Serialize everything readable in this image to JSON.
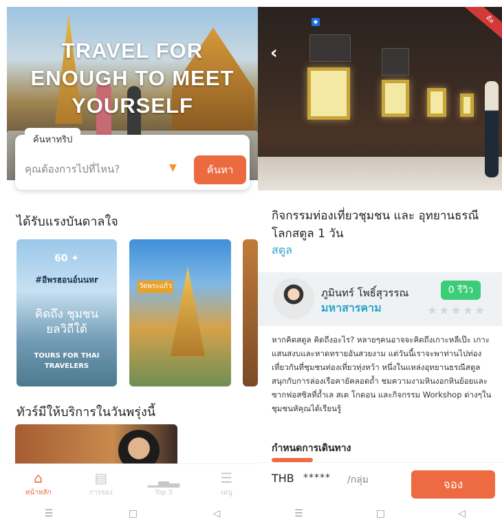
{
  "left": {
    "hero": {
      "title": "TRAVEL FOR\nENOUGH TO MEET\nYOURSELF"
    },
    "search": {
      "tab_label": "ค้นหาทริป",
      "placeholder": "คุณต้องการไปที่ไหน?",
      "button_label": "ค้นหา"
    },
    "inspiration_title": "ได้รับแรงบันดาลใจ",
    "promos": [
      {
        "hashtag": "#อีพรฮอนอ์นนหr",
        "headline": "คิดถึง ชุมชน\nยลวิถีใต้",
        "footer": "TOURS FOR THAI\nTRAVELERS"
      },
      {
        "caption": "วัดพระแก้ว"
      }
    ],
    "tomorrow_title": "ทัวร์มีให้บริการในวันพรุ่งนี้",
    "nav": [
      {
        "label": "หน้าหลัก",
        "icon": "home-icon",
        "active": true
      },
      {
        "label": "การจอง",
        "icon": "booking-icon",
        "active": false
      },
      {
        "label": "Top 5",
        "icon": "chart-icon",
        "active": false
      },
      {
        "label": "เมนู",
        "icon": "menu-icon",
        "active": false
      }
    ]
  },
  "right": {
    "gallery": {
      "badge": "ดีล"
    },
    "activity": {
      "title": "กิจกรรมท่องเที่ยวชุมชน และ อุทยานธรณีโลกสตูล 1 วัน",
      "province": "สตูล"
    },
    "host": {
      "name": "ภูมินทร์ โพธิ์สุวรรณ",
      "province": "มหาสารคาม",
      "review_label": "0 รีวิว",
      "stars": "★★★★★"
    },
    "description": "หากคิดสตูล คิดถึงอะไร? หลายๆคนอาจจะคิดถึงเกาะหลีเป๊ะ เกาะแสนสงบและหาดทรายอันสวยงาม แต่วันนี้เราจะพาท่านไปท่องเที่ยวกันที่ชุมชนท่องเที่ยวทุ่งหว้า หนึ่งในแหล่งอุทยานธรณีสตูล สนุกกับการล่องเรือคายัคลอดถ้ำ ชมความงามหินงอกหินย้อยและซากฟอสซิลที่ถ้ำเล สเต โกดอน และกิจกรรม Workshop ต่างๆในชุมชนหัคุณได้เรียนรู้",
    "schedule_title": "กำหนดการเดินทาง",
    "booking": {
      "currency": "THB",
      "price_mask": "*****",
      "unit": "/กลุ่ม",
      "button_label": "จอง"
    }
  },
  "system_bar": {
    "icons": [
      "recent-apps-icon",
      "home-circle-icon",
      "back-triangle-icon"
    ]
  },
  "colors": {
    "accent": "#ec6a3f",
    "link": "#2aa3c7",
    "review_green": "#3ccd79"
  }
}
